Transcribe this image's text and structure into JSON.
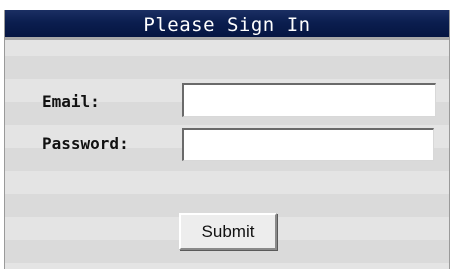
{
  "header": {
    "title": "Please Sign In"
  },
  "form": {
    "email_label": "Email:",
    "email_value": "",
    "password_label": "Password:",
    "password_value": "",
    "submit_label": "Submit"
  },
  "colors": {
    "header_bg": "#051542",
    "header_text": "#ffffff",
    "panel_bg_light": "#e4e4e4",
    "panel_bg_dark": "#dadada"
  }
}
